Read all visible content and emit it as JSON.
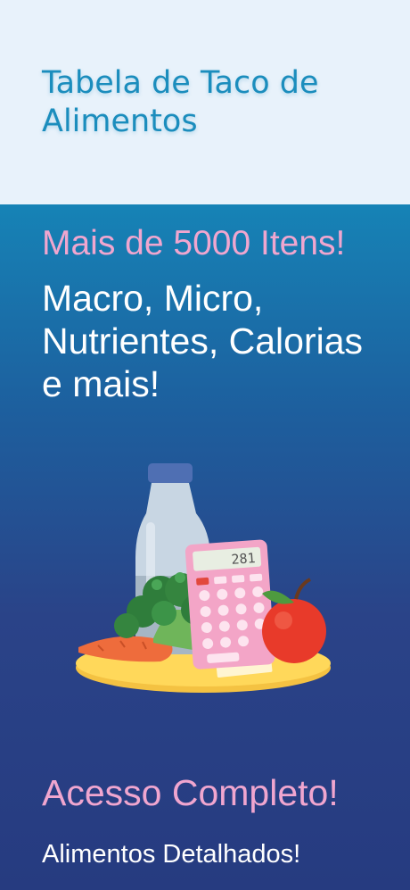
{
  "header": {
    "title": "Tabela de Taco de Alimentos"
  },
  "promo": {
    "headline": "Mais de 5000 Itens!",
    "description": "Macro, Micro, Nutrientes, Calorias e mais!",
    "calculator_display": "281",
    "headline_2": "Acesso Completo!",
    "subtext": "Alimentos Detalhados!"
  },
  "colors": {
    "header_bg": "#e8f2fb",
    "title": "#1b8dbd",
    "accent_pink": "#f0a6cf",
    "gradient_top": "#1683b6",
    "gradient_bottom": "#263b80"
  }
}
